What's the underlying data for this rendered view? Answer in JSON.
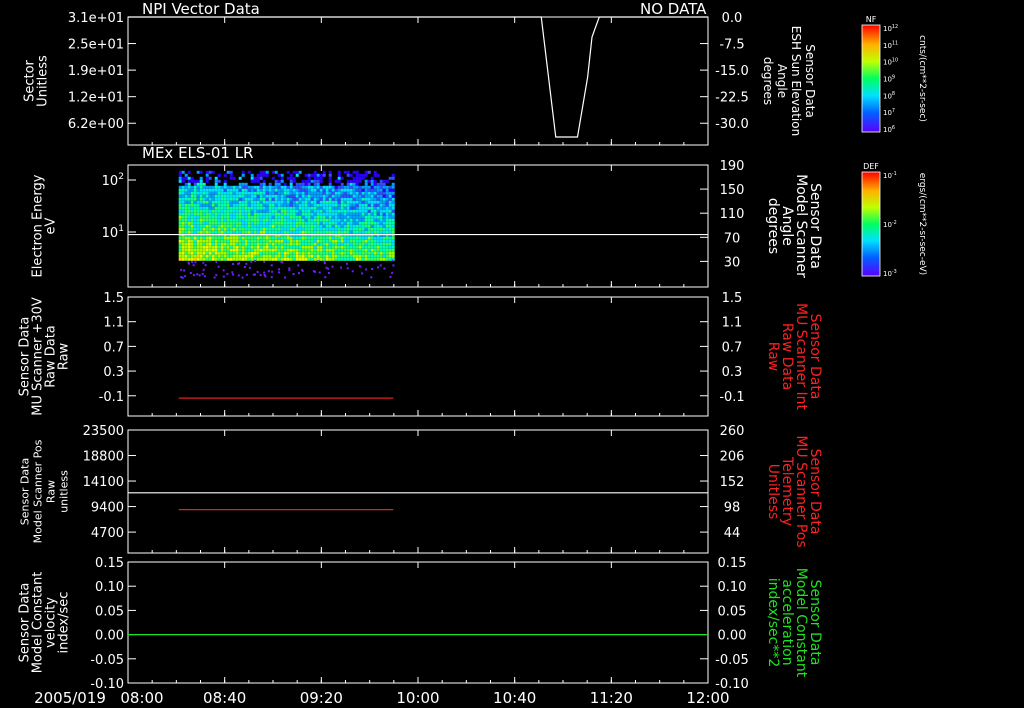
{
  "time_axis": {
    "date_label": "2005/019",
    "ticks": [
      "08:00",
      "08:40",
      "09:20",
      "10:00",
      "10:40",
      "11:20",
      "12:00"
    ],
    "range_hours": [
      8.0,
      12.0
    ]
  },
  "colorbars": [
    {
      "tag": "NF",
      "unit": "cnts/(cm**2-sr-sec)",
      "tick_labels": [
        "10^12",
        "10^11",
        "10^10",
        "10^9",
        "10^8",
        "10^7",
        "10^6"
      ]
    },
    {
      "tag": "DEF",
      "unit": "ergs/(cm**2-sr-sec-eV)",
      "tick_labels": [
        "10^-1",
        "10^-2",
        "10^-3"
      ]
    }
  ],
  "panels": [
    {
      "title": "NPI Vector Data",
      "status": "NO DATA",
      "left_axis_label": [
        "Sector",
        "Unitless"
      ],
      "left_ticks": [
        "3.1e+01",
        "2.5e+01",
        "1.9e+01",
        "1.2e+01",
        "6.2e+00"
      ],
      "right_axis_label": [
        "Sensor Data",
        "ESH Sun Elevation",
        "Angle",
        "degrees"
      ],
      "right_ticks": [
        "0.0",
        "-7.5",
        "-15.0",
        "-22.5",
        "-30.0"
      ],
      "right_label_color": "#ffffff"
    },
    {
      "title": "MEx ELS-01 LR",
      "left_axis_label": [
        "Electron Energy",
        "eV"
      ],
      "left_ticks": [
        "10^2",
        "10^1"
      ],
      "right_axis_label": [
        "Sensor Data",
        "Model Scanner",
        "Angle",
        "degrees"
      ],
      "right_ticks": [
        "190",
        "150",
        "110",
        "70",
        "30"
      ],
      "right_label_color": "#ffffff"
    },
    {
      "left_axis_label": [
        "Sensor Data",
        "MU Scanner +30V",
        "Raw Data",
        "Raw"
      ],
      "left_ticks": [
        "1.5",
        "1.1",
        "0.7",
        "0.3",
        "-0.1"
      ],
      "right_axis_label": [
        "Sensor Data",
        "MU Scanner Int",
        "Raw Data",
        "Raw"
      ],
      "right_ticks": [
        "1.5",
        "1.1",
        "0.7",
        "0.3",
        "-0.1"
      ],
      "right_label_color": "#ff2020"
    },
    {
      "left_axis_label": [
        "Sensor Data",
        "Model Scanner Pos",
        "Raw",
        "unitless"
      ],
      "left_ticks": [
        "23500",
        "18800",
        "14100",
        "9400",
        "4700"
      ],
      "right_axis_label": [
        "Sensor Data",
        "MU Scanner Pos",
        "Telemetry",
        "Unitless"
      ],
      "right_ticks": [
        "260",
        "206",
        "152",
        "98",
        "44"
      ],
      "right_label_color": "#ff2020"
    },
    {
      "left_axis_label": [
        "Sensor Data",
        "Model Constant",
        "velocity",
        "index/sec"
      ],
      "left_ticks": [
        "0.15",
        "0.10",
        "0.05",
        "0.00",
        "-0.05",
        "-0.10"
      ],
      "right_axis_label": [
        "Sensor Data",
        "Model Constant",
        "acceleration",
        "index/sec**2"
      ],
      "right_ticks": [
        "0.15",
        "0.10",
        "0.05",
        "0.00",
        "-0.05",
        "-0.10"
      ],
      "right_label_color": "#20e020"
    }
  ],
  "chart_data": [
    {
      "type": "line",
      "panel": 1,
      "series": [
        {
          "name": "ESH Sun Elevation Angle",
          "color": "#ffffff",
          "x": [
            8.0,
            10.85,
            10.9,
            10.95,
            11.1,
            11.17,
            11.2,
            11.25,
            12.0
          ],
          "y": [
            0.0,
            0.0,
            -15.0,
            -30.0,
            -30.0,
            -15.0,
            -5.0,
            0.0,
            0.0
          ]
        }
      ],
      "ylim": [
        -32,
        0
      ]
    },
    {
      "type": "heatmap",
      "panel": 2,
      "x_range": [
        8.35,
        9.83
      ],
      "energy_range_eV": [
        3,
        150
      ],
      "yscale": "log",
      "overlay_line": {
        "name": "Model Scanner Angle",
        "value": 90,
        "color": "#ffffff",
        "ylim": [
          10,
          190
        ]
      }
    },
    {
      "type": "line",
      "panel": 3,
      "series": [
        {
          "name": "MU Scanner Int",
          "color": "#e02020",
          "x": [
            8.35,
            9.83
          ],
          "y": [
            -0.03,
            -0.03
          ]
        }
      ],
      "ylim": [
        -0.3,
        1.5
      ]
    },
    {
      "type": "line",
      "panel": 4,
      "series": [
        {
          "name": "Model Scanner Pos",
          "color": "#ffffff",
          "x": [
            8.0,
            12.0
          ],
          "y": [
            11500,
            11500
          ]
        },
        {
          "name": "MU Scanner Pos",
          "color": "#e02020",
          "x": [
            8.35,
            9.83
          ],
          "y": [
            8300,
            8300
          ]
        }
      ],
      "ylim": [
        0,
        23500
      ]
    },
    {
      "type": "line",
      "panel": 5,
      "series": [
        {
          "name": "Model Constant velocity",
          "color": "#20e020",
          "x": [
            8.0,
            12.0
          ],
          "y": [
            0.0,
            0.0
          ]
        }
      ],
      "ylim": [
        -0.1,
        0.15
      ]
    }
  ]
}
